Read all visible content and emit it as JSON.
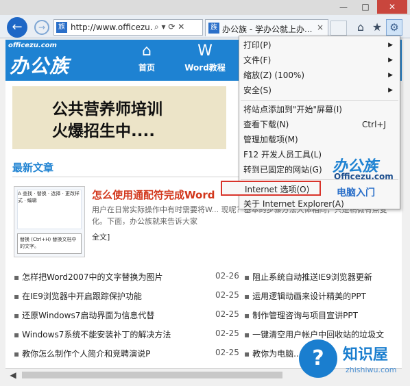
{
  "window": {
    "minimize": "—",
    "maximize": "□",
    "close": "✕"
  },
  "address": {
    "url": "http://www.officezu.com/",
    "controls": "⌕ ▾ ⟳ ✕"
  },
  "tab": {
    "title": "办公族 - 学办公就上办...",
    "close": "×"
  },
  "site": {
    "logo_small": "officezu.com",
    "logo_big": "办公族",
    "nav": [
      {
        "label": "首页",
        "icon": "home-icon"
      },
      {
        "label": "Word教程",
        "icon": "word-icon"
      }
    ],
    "banner_line1": "公共营养师培训",
    "banner_line2": "火爆招生中....",
    "latest_title": "最新文章",
    "featured": {
      "title": "怎么使用通配符完成Word",
      "summary": "用户在日常实际操作中有时需要将W... 现呢？基本的步骤方法大体相同，只是稍微有点变化。下面，办公族就来告诉大家",
      "tail": "全文]",
      "thumb_ribbon": "A 查找 · 替换 · 选择 · 更改样式 · 编辑",
      "thumb_tip": "替换 (Ctrl+H) 替换文档中的文字。"
    },
    "news_left": [
      {
        "title": "怎样把Word2007中的文字替换为图片",
        "date": "02-26"
      },
      {
        "title": "在IE9浏览器中开启跟踪保护功能",
        "date": "02-25"
      },
      {
        "title": "还原Windows7启动界面为信息代替",
        "date": "02-25"
      },
      {
        "title": "Windows7系统不能安装补丁的解决方法",
        "date": "02-25"
      },
      {
        "title": "教你怎么制作个人简介和竞聘演说P",
        "date": "02-25"
      }
    ],
    "news_right": [
      {
        "title": "阻止系统自动推送IE9浏览器更新"
      },
      {
        "title": "运用逻辑动画来设计精美的PPT"
      },
      {
        "title": "制作管理咨询与项目宣讲PPT"
      },
      {
        "title": "一键清空用户帐户中回收站的垃圾文"
      },
      {
        "title": "教你为电脑..."
      }
    ]
  },
  "menu": {
    "items": [
      {
        "label": "打印(P)",
        "arrow": "▶"
      },
      {
        "label": "文件(F)",
        "arrow": "▶"
      },
      {
        "label": "缩放(Z) (100%)",
        "arrow": "▶"
      },
      {
        "label": "安全(S)",
        "arrow": "▶"
      },
      {
        "label": "将站点添加到\"开始\"屏幕(I)"
      },
      {
        "label": "查看下载(N)",
        "shortcut": "Ctrl+J"
      },
      {
        "label": "管理加载项(M)"
      },
      {
        "label": "F12 开发人员工具(L)"
      },
      {
        "label": "转到已固定的网站(G)"
      },
      {
        "label": "Internet 选项(O)"
      },
      {
        "label": "关于 Internet Explorer(A)"
      }
    ]
  },
  "watermark": {
    "title": "办公族",
    "sub": "Officezu.com",
    "tag": "电脑入门"
  },
  "badge": {
    "glyph": "?",
    "title": "知识屋",
    "url": "zhishiwu.com"
  },
  "colors": {
    "accent": "#1e82d2",
    "highlight": "#d8332a",
    "featured_title": "#d2371c"
  }
}
